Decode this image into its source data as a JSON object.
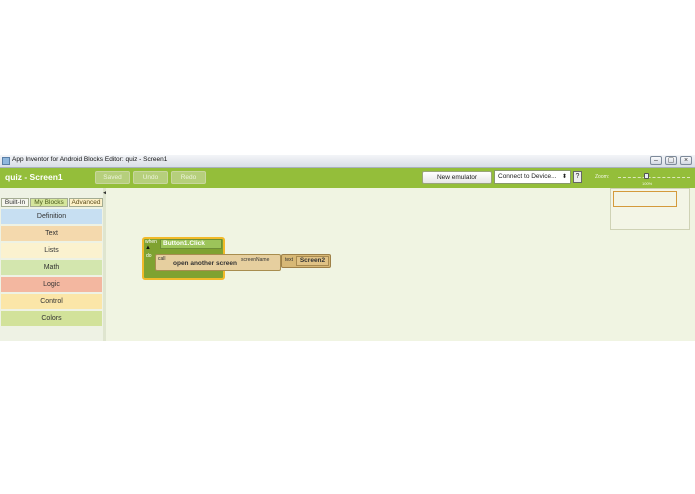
{
  "window": {
    "title": "App Inventor for Android Blocks Editor: quiz - Screen1",
    "min_label": "–",
    "max_label": "▢",
    "close_label": "×"
  },
  "toolbar": {
    "project": "quiz - Screen1",
    "saved": "Saved",
    "undo": "Undo",
    "redo": "Redo",
    "new_emulator": "New emulator",
    "connect_device": "Connect to Device...",
    "help": "?",
    "zoom_label": "Zoom:",
    "zoom_value": "100%"
  },
  "sidebar": {
    "tabs": [
      "Built-In",
      "My Blocks",
      "Advanced"
    ],
    "categories": [
      {
        "label": "Definition",
        "color": "#c7dff2"
      },
      {
        "label": "Text",
        "color": "#f4d9ad"
      },
      {
        "label": "Lists",
        "color": "#fbf2cf"
      },
      {
        "label": "Math",
        "color": "#d3e6ae"
      },
      {
        "label": "Logic",
        "color": "#f3b7a0"
      },
      {
        "label": "Control",
        "color": "#fbe6a8"
      },
      {
        "label": "Colors",
        "color": "#d2e29a"
      }
    ]
  },
  "blocks": {
    "event_when": "when",
    "event_do": "do",
    "event_name": "Button1.Click",
    "call_label": "call",
    "call_name": "open another screen",
    "param_name": "screenName",
    "text_label": "text",
    "text_value": "Screen2"
  }
}
